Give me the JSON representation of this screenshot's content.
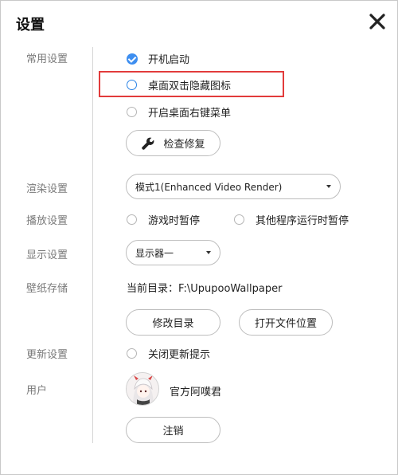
{
  "window": {
    "title": "设置"
  },
  "icons": {
    "close": "close-icon",
    "wrench": "wrench-icon",
    "caret": "chevron-down-icon"
  },
  "colors": {
    "accent": "#3d8ef0",
    "highlight": "#e23b3b"
  },
  "sections": {
    "common": {
      "label": "常用设置",
      "auto_start": {
        "label": "开机启动",
        "checked": true
      },
      "desktop_dblclick_hide": {
        "label": "桌面双击隐藏图标",
        "checked": false
      },
      "desktop_context_menu": {
        "label": "开启桌面右键菜单",
        "checked": false
      },
      "repair_button": "检查修复"
    },
    "render": {
      "label": "渲染设置",
      "selected": "模式1(Enhanced Video Render)"
    },
    "playback": {
      "label": "播放设置",
      "pause_game": "游戏时暂停",
      "pause_other": "其他程序运行时暂停"
    },
    "display": {
      "label": "显示设置",
      "selected": "显示器一"
    },
    "storage": {
      "label": "壁纸存储",
      "current_dir": "当前目录：F:\\UpupooWallpaper",
      "modify_button": "修改目录",
      "open_button": "打开文件位置"
    },
    "update": {
      "label": "更新设置",
      "close_update_tip": "关闭更新提示"
    },
    "user": {
      "label": "用户",
      "username": "官方阿噗君",
      "logout_button": "注销"
    }
  }
}
